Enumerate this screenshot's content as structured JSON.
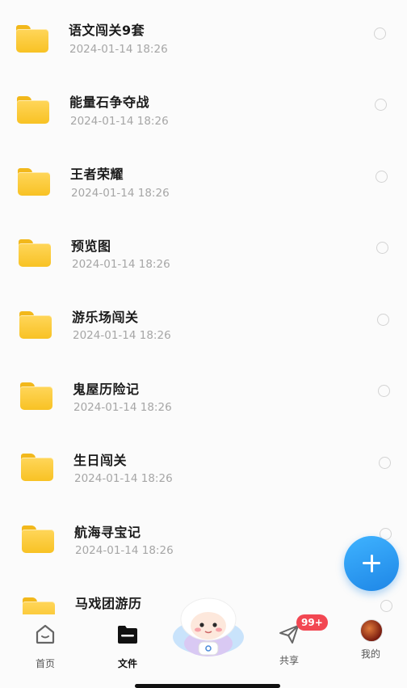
{
  "files": [
    {
      "name": "语文闯关9套",
      "date": "2024-01-14 18:26"
    },
    {
      "name": "能量石争夺战",
      "date": "2024-01-14 18:26"
    },
    {
      "name": "王者荣耀",
      "date": "2024-01-14 18:26"
    },
    {
      "name": "预览图",
      "date": "2024-01-14 18:26"
    },
    {
      "name": "游乐场闯关",
      "date": "2024-01-14 18:26"
    },
    {
      "name": "鬼屋历险记",
      "date": "2024-01-14 18:26"
    },
    {
      "name": "生日闯关",
      "date": "2024-01-14 18:26"
    },
    {
      "name": "航海寻宝记",
      "date": "2024-01-14 18:26"
    },
    {
      "name": "马戏团游历",
      "date": ""
    }
  ],
  "tabbar": {
    "home": {
      "label": "首页",
      "icon": "home-icon"
    },
    "files": {
      "label": "文件",
      "icon": "folder-icon"
    },
    "mascot": {
      "icon": "mascot-icon"
    },
    "share": {
      "label": "共享",
      "icon": "paper-plane-icon",
      "badge": "99+"
    },
    "me": {
      "label": "我的",
      "icon": "avatar"
    }
  },
  "fab": {
    "icon": "plus-icon"
  },
  "colors": {
    "accent": "#1e86e6",
    "folder": "#f8c224",
    "badge": "#f24752"
  }
}
